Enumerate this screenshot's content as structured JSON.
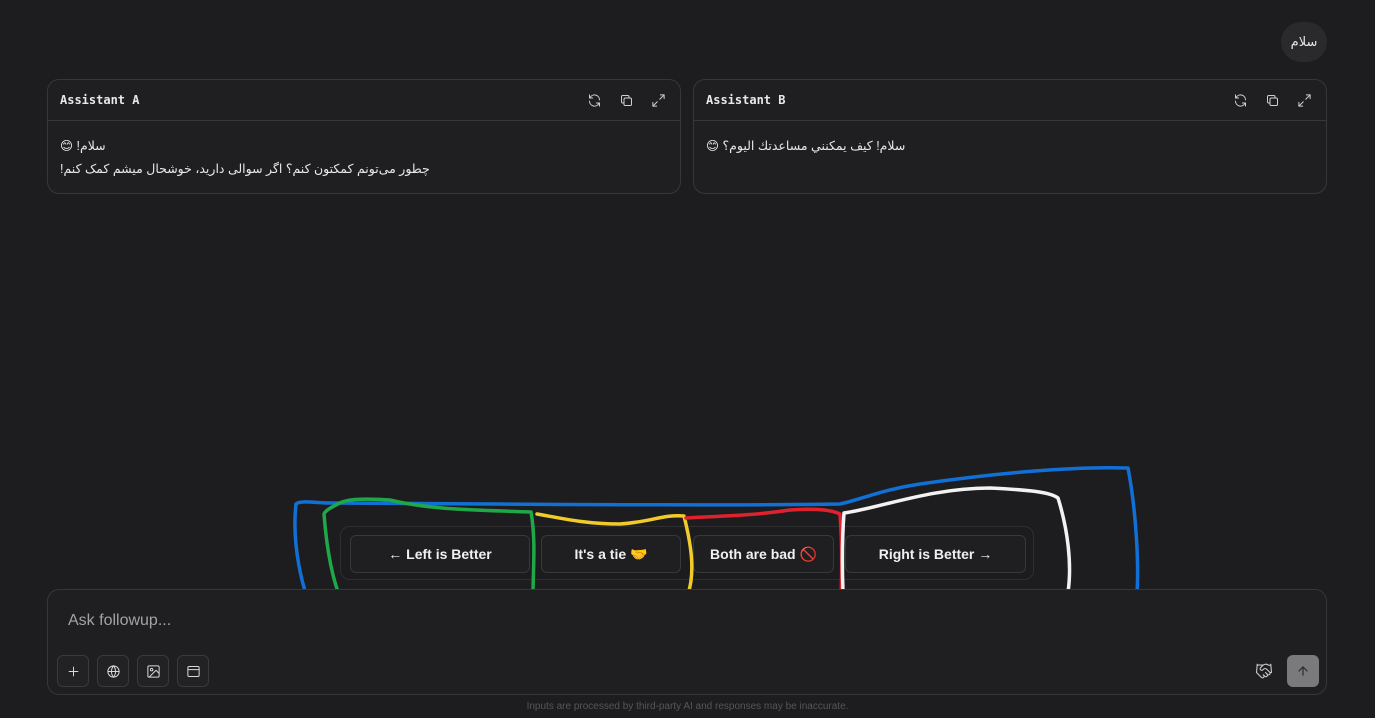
{
  "user_message": "سلام",
  "assistant_a": {
    "title": "Assistant A",
    "line1": "سلام! 😊",
    "line2": "چطور می‌تونم کمکتون کنم؟ اگر سوالی دارید، خوشحال میشم کمک کنم!"
  },
  "assistant_b": {
    "title": "Assistant B",
    "line1": "سلام! كيف يمكنني مساعدتك اليوم؟ 😊"
  },
  "vote": {
    "left": "← Left is Better",
    "tie": "It's a tie 🤝",
    "bad": "Both are bad 🚫",
    "right": "Right is Better →"
  },
  "composer": {
    "placeholder": "Ask followup..."
  },
  "disclaimer": "Inputs are processed by third-party AI and responses may be inaccurate.",
  "annotation_colors": {
    "outer": "#1170d6",
    "left": "#1fa847",
    "tie": "#f2cb2a",
    "bad": "#e0222e",
    "right": "#f2f2f2"
  }
}
